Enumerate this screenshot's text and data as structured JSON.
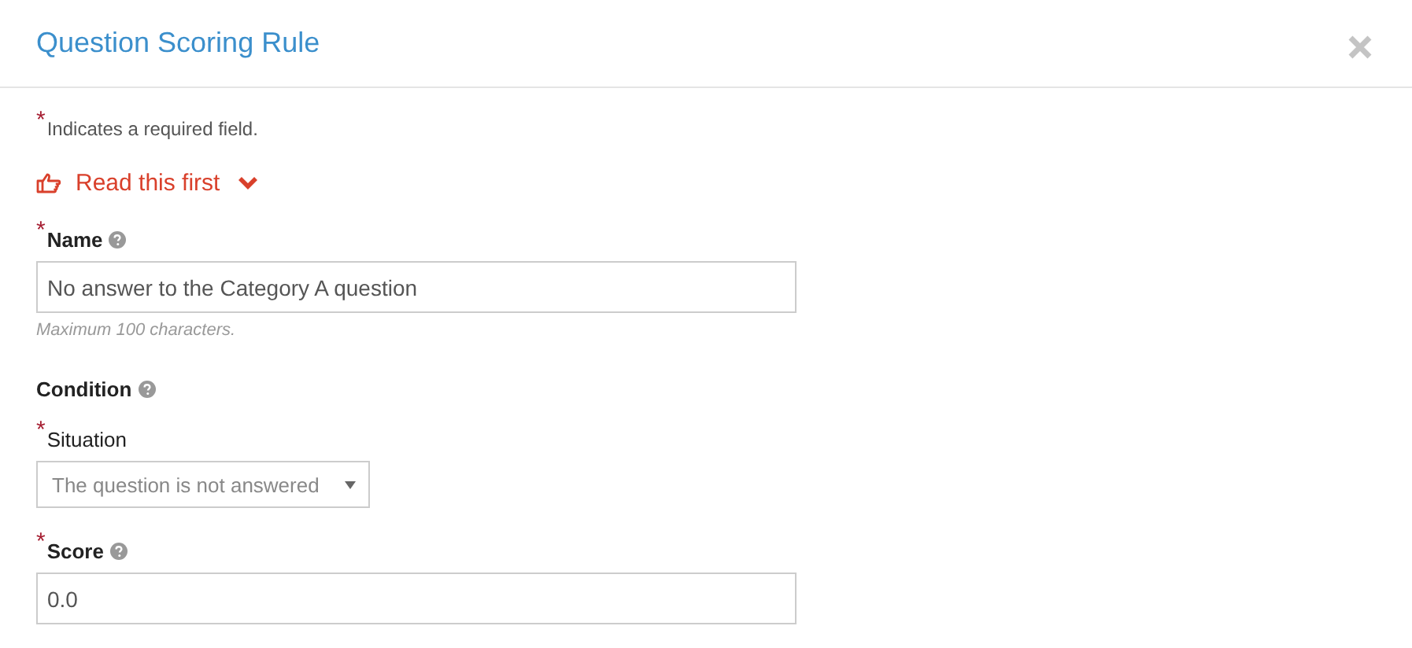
{
  "dialog": {
    "title": "Question Scoring Rule"
  },
  "required_note": {
    "mark": "*",
    "text": "Indicates a required field."
  },
  "disclosure": {
    "label": "Read this first",
    "expanded": false
  },
  "fields": [
    {
      "kind": "text",
      "mark": "*",
      "label": "Name",
      "bold": true,
      "help": true,
      "value": "No answer to the Category A question",
      "hint": "Maximum 100 characters."
    },
    {
      "kind": "heading",
      "label": "Condition",
      "help": true
    },
    {
      "kind": "select",
      "mark": "*",
      "label": "Situation",
      "bold": false,
      "value": "The question is not answered"
    },
    {
      "kind": "text",
      "mark": "*",
      "label": "Score",
      "bold": true,
      "help": true,
      "value": "0.0"
    }
  ]
}
